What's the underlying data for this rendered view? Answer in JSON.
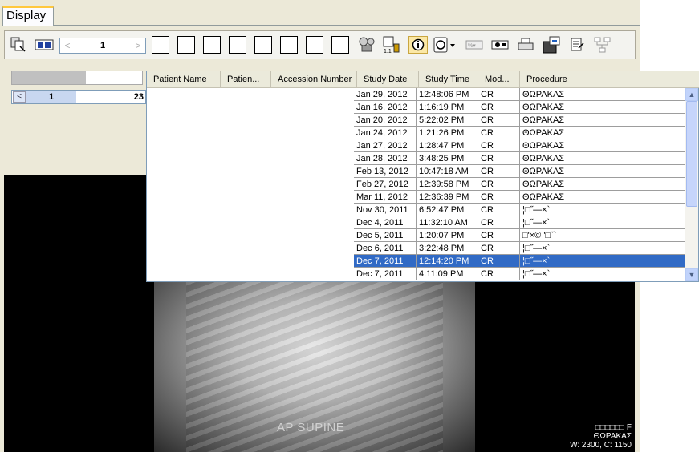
{
  "tab": {
    "label": "Display"
  },
  "toolbar": {
    "page_value": "1",
    "icons": [
      "series-icon",
      "compare-icon",
      "layout-1x1-icon",
      "layout-1x2-icon",
      "layout-2x1-icon",
      "layout-2x2-icon",
      "layout-2x3-icon",
      "layout-3x3-icon",
      "layout-4x4-icon",
      "cine-icon",
      "scale-1to1-icon",
      "info-icon",
      "overlay-icon",
      "zoom-percent-icon",
      "window-level-icon",
      "print-icon",
      "export-icon",
      "report-icon",
      "network-icon"
    ]
  },
  "left_panel": {
    "current": "1",
    "total": "23"
  },
  "image_overlay": {
    "view_label": "AP SUPINE",
    "line1": "□□□□□□ F",
    "line2": "ΘΩΡΑΚΑΣ",
    "line3": "W: 2300, C: 1150"
  },
  "study_grid": {
    "columns": [
      "Patient Name",
      "Patien...",
      "Accession Number",
      "Study Date",
      "Study Time",
      "Mod...",
      "Procedure"
    ],
    "rows": [
      {
        "date": "Jan 29, 2012",
        "time": "12:48:06 PM",
        "mod": "CR",
        "proc": "ΘΩΡΑΚΑΣ"
      },
      {
        "date": "Jan 16, 2012",
        "time": "1:16:19 PM",
        "mod": "CR",
        "proc": "ΘΩΡΑΚΑΣ"
      },
      {
        "date": "Jan 20, 2012",
        "time": "5:22:02 PM",
        "mod": "CR",
        "proc": "ΘΩΡΑΚΑΣ"
      },
      {
        "date": "Jan 24, 2012",
        "time": "1:21:26 PM",
        "mod": "CR",
        "proc": "ΘΩΡΑΚΑΣ"
      },
      {
        "date": "Jan 27, 2012",
        "time": "1:28:47 PM",
        "mod": "CR",
        "proc": "ΘΩΡΑΚΑΣ"
      },
      {
        "date": "Jan 28, 2012",
        "time": "3:48:25 PM",
        "mod": "CR",
        "proc": "ΘΩΡΑΚΑΣ"
      },
      {
        "date": "Feb 13, 2012",
        "time": "10:47:18 AM",
        "mod": "CR",
        "proc": "ΘΩΡΑΚΑΣ"
      },
      {
        "date": "Feb 27, 2012",
        "time": "12:39:58 PM",
        "mod": "CR",
        "proc": "ΘΩΡΑΚΑΣ"
      },
      {
        "date": "Mar 11, 2012",
        "time": "12:36:39 PM",
        "mod": "CR",
        "proc": "ΘΩΡΑΚΑΣ"
      },
      {
        "date": "Nov 30, 2011",
        "time": "6:52:47 PM",
        "mod": "CR",
        "proc": "¦□˝—×`"
      },
      {
        "date": "Dec 4, 2011",
        "time": "11:32:10 AM",
        "mod": "CR",
        "proc": "¦□˝—×`"
      },
      {
        "date": "Dec 5, 2011",
        "time": "1:20:07 PM",
        "mod": "CR",
        "proc": "□'×© '□˝`"
      },
      {
        "date": "Dec 6, 2011",
        "time": "3:22:48 PM",
        "mod": "CR",
        "proc": "¦□˝—×`"
      },
      {
        "date": "Dec 7, 2011",
        "time": "12:14:20 PM",
        "mod": "CR",
        "proc": "¦□˝—×`",
        "selected": true
      },
      {
        "date": "Dec 7, 2011",
        "time": "4:11:09 PM",
        "mod": "CR",
        "proc": "¦□˝—×`"
      }
    ]
  }
}
